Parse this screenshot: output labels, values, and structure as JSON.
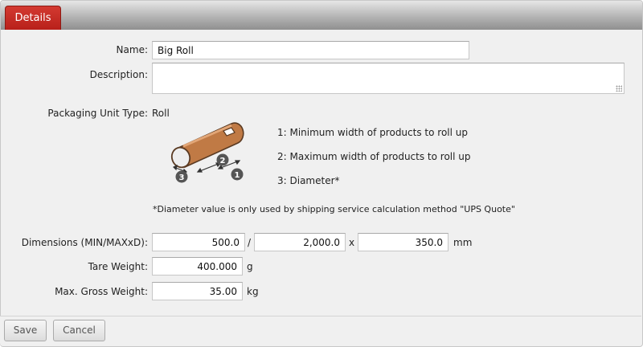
{
  "tabs": {
    "details_label": "Details"
  },
  "form": {
    "name_label": "Name:",
    "name_value": "Big Roll",
    "description_label": "Description:",
    "description_value": "",
    "packaging_label": "Packaging Unit Type:",
    "packaging_value": "Roll"
  },
  "diagram": {
    "markers": [
      "3",
      "2",
      "1"
    ],
    "legend": [
      "1: Minimum width of products to roll up",
      "2: Maximum width of products to roll up",
      "3: Diameter*"
    ],
    "note": "*Diameter value is only used by shipping service calculation method \"UPS Quote\""
  },
  "dimensions": {
    "label": "Dimensions (MIN/MAXxD):",
    "min": "500.0",
    "max": "2,000.0",
    "diameter": "350.0",
    "sep1": "/",
    "sep2": "x",
    "unit": "mm"
  },
  "tare": {
    "label": "Tare Weight:",
    "value": "400.000",
    "unit": "g"
  },
  "gross": {
    "label": "Max. Gross Weight:",
    "value": "35.00",
    "unit": "kg"
  },
  "buttons": {
    "save": "Save",
    "cancel": "Cancel"
  },
  "colors": {
    "tab_red": "#c0261f",
    "roll_brown": "#c07a45"
  }
}
